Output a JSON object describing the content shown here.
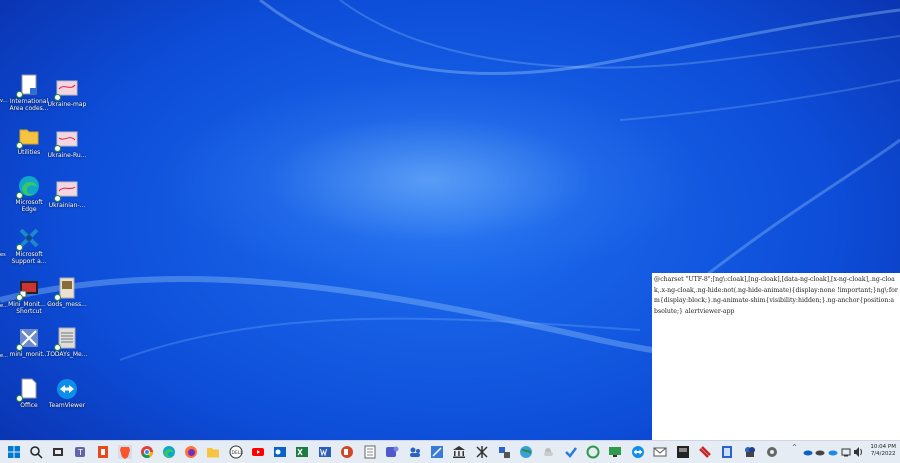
{
  "desktop": {
    "left_edge_labels": [
      "v...",
      "es",
      "e...",
      "e..."
    ],
    "icons": [
      {
        "label": "International Area codes...",
        "icon": "document-icon"
      },
      {
        "label": "Ukraine-map",
        "icon": "image-icon"
      },
      {
        "label": "Utilities",
        "icon": "folder-icon"
      },
      {
        "label": "Ukraine-Ru...",
        "icon": "image-icon"
      },
      {
        "label": "Microsoft Edge",
        "icon": "edge-icon"
      },
      {
        "label": "Ukrainian-...",
        "icon": "image-icon"
      },
      {
        "label": "Microsoft Support a...",
        "icon": "support-icon"
      },
      {
        "label": "Mini_Monit... - Shortcut",
        "icon": "shortcut-icon"
      },
      {
        "label": "Gods_mess...",
        "icon": "image-icon"
      },
      {
        "label": "mini_monit...",
        "icon": "app-icon"
      },
      {
        "label": "TODAYs_Me...",
        "icon": "image-icon"
      },
      {
        "label": "Office",
        "icon": "document-icon"
      },
      {
        "label": "TeamViewer",
        "icon": "teamviewer-icon"
      }
    ]
  },
  "popup": {
    "text": "@charset \"UTF-8\";[ng\\:cloak],[ng-cloak],[data-ng-cloak],[x-ng-cloak],.ng-cloak,.x-ng-cloak,.ng-hide:not(.ng-hide-animate){display:none !important;}ng\\:form{display:block;}.ng-animate-shim{visibility:hidden;}.ng-anchor{position:absolute;} alertviewer-app"
  },
  "taskbar": {
    "icons": [
      "start-icon",
      "search-icon",
      "task-view-icon",
      "teams-icon",
      "office-icon",
      "brave-icon",
      "chrome-icon",
      "edge-icon",
      "firefox-icon",
      "explorer-icon",
      "dell-icon",
      "youtube-icon",
      "outlook-icon",
      "excel-icon",
      "word-icon",
      "powerpoint-icon",
      "notepad-icon",
      "teams-work-icon",
      "people-icon",
      "sketch-icon",
      "bank-icon",
      "network-icon",
      "tools-icon",
      "globe-icon",
      "weather-icon",
      "todo-icon",
      "chat-icon",
      "monitor-icon",
      "teamviewer-icon",
      "mail-icon",
      "terminal-icon",
      "tools-red-icon",
      "note-icon",
      "puzzle-icon",
      "settings-icon"
    ],
    "tray": {
      "chevron": "^",
      "time": "10:04 PM",
      "date": "7/4/2022"
    },
    "colors": {
      "accent": "#0078d4"
    }
  }
}
